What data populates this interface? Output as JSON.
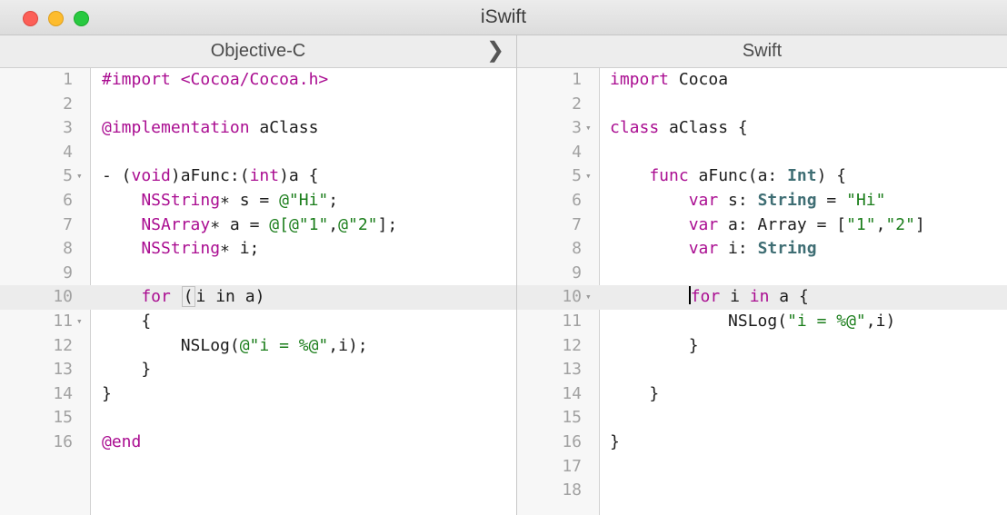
{
  "window": {
    "title": "iSwift"
  },
  "left_pane": {
    "header": "Objective-C",
    "expand_icon": "chevron-right-icon",
    "lines": [
      {
        "num": "1",
        "fold": false,
        "highlight": false,
        "segments": [
          {
            "t": "#import <Cocoa/Cocoa.h>",
            "c": "kw2"
          }
        ]
      },
      {
        "num": "2",
        "fold": false,
        "highlight": false,
        "segments": []
      },
      {
        "num": "3",
        "fold": false,
        "highlight": false,
        "segments": [
          {
            "t": "@implementation",
            "c": "kw"
          },
          {
            "t": " aClass",
            "c": ""
          }
        ]
      },
      {
        "num": "4",
        "fold": false,
        "highlight": false,
        "segments": []
      },
      {
        "num": "5",
        "fold": true,
        "highlight": false,
        "segments": [
          {
            "t": "- (",
            "c": ""
          },
          {
            "t": "void",
            "c": "kw"
          },
          {
            "t": ")aFunc:(",
            "c": ""
          },
          {
            "t": "int",
            "c": "kw"
          },
          {
            "t": ")a {",
            "c": ""
          }
        ]
      },
      {
        "num": "6",
        "fold": false,
        "highlight": false,
        "segments": [
          {
            "t": "    NSString",
            "c": "kw"
          },
          {
            "t": "∗ s = ",
            "c": ""
          },
          {
            "t": "@\"Hi\"",
            "c": "str"
          },
          {
            "t": ";",
            "c": ""
          }
        ]
      },
      {
        "num": "7",
        "fold": false,
        "highlight": false,
        "segments": [
          {
            "t": "    NSArray",
            "c": "kw"
          },
          {
            "t": "∗ a = ",
            "c": ""
          },
          {
            "t": "@[",
            "c": "str"
          },
          {
            "t": "@\"1\"",
            "c": "str"
          },
          {
            "t": ",",
            "c": ""
          },
          {
            "t": "@\"2\"",
            "c": "str"
          },
          {
            "t": "];",
            "c": ""
          }
        ]
      },
      {
        "num": "8",
        "fold": false,
        "highlight": false,
        "segments": [
          {
            "t": "    NSString",
            "c": "kw"
          },
          {
            "t": "∗ i;",
            "c": ""
          }
        ]
      },
      {
        "num": "9",
        "fold": false,
        "highlight": false,
        "segments": []
      },
      {
        "num": "10",
        "fold": false,
        "highlight": true,
        "segments": [
          {
            "t": "    for ",
            "c": "kw"
          },
          {
            "t": "(",
            "c": "brk"
          },
          {
            "t": "i in a)",
            "c": ""
          }
        ]
      },
      {
        "num": "11",
        "fold": true,
        "highlight": false,
        "segments": [
          {
            "t": "    {",
            "c": ""
          }
        ]
      },
      {
        "num": "12",
        "fold": false,
        "highlight": false,
        "segments": [
          {
            "t": "        NSLog(",
            "c": ""
          },
          {
            "t": "@\"i = %@\"",
            "c": "str"
          },
          {
            "t": ",i);",
            "c": ""
          }
        ]
      },
      {
        "num": "13",
        "fold": false,
        "highlight": false,
        "segments": [
          {
            "t": "    }",
            "c": ""
          }
        ]
      },
      {
        "num": "14",
        "fold": false,
        "highlight": false,
        "segments": [
          {
            "t": "}",
            "c": ""
          }
        ]
      },
      {
        "num": "15",
        "fold": false,
        "highlight": false,
        "segments": []
      },
      {
        "num": "16",
        "fold": false,
        "highlight": false,
        "segments": [
          {
            "t": "@end",
            "c": "kw"
          }
        ]
      }
    ]
  },
  "right_pane": {
    "header": "Swift",
    "lines": [
      {
        "num": "1",
        "fold": false,
        "highlight": false,
        "segments": [
          {
            "t": "import ",
            "c": "kw"
          },
          {
            "t": "Cocoa",
            "c": ""
          }
        ]
      },
      {
        "num": "2",
        "fold": false,
        "highlight": false,
        "segments": []
      },
      {
        "num": "3",
        "fold": true,
        "highlight": false,
        "segments": [
          {
            "t": "class ",
            "c": "kw"
          },
          {
            "t": "aClass {",
            "c": ""
          }
        ]
      },
      {
        "num": "4",
        "fold": false,
        "highlight": false,
        "segments": []
      },
      {
        "num": "5",
        "fold": true,
        "highlight": false,
        "segments": [
          {
            "t": "    func ",
            "c": "kw"
          },
          {
            "t": "aFunc(a: ",
            "c": ""
          },
          {
            "t": "Int",
            "c": "ty"
          },
          {
            "t": ") {",
            "c": ""
          }
        ]
      },
      {
        "num": "6",
        "fold": false,
        "highlight": false,
        "segments": [
          {
            "t": "        var ",
            "c": "kw"
          },
          {
            "t": "s: ",
            "c": ""
          },
          {
            "t": "String",
            "c": "ty"
          },
          {
            "t": " = ",
            "c": ""
          },
          {
            "t": "\"Hi\"",
            "c": "str"
          }
        ]
      },
      {
        "num": "7",
        "fold": false,
        "highlight": false,
        "segments": [
          {
            "t": "        var ",
            "c": "kw"
          },
          {
            "t": "a: Array = [",
            "c": ""
          },
          {
            "t": "\"1\"",
            "c": "str"
          },
          {
            "t": ",",
            "c": ""
          },
          {
            "t": "\"2\"",
            "c": "str"
          },
          {
            "t": "]",
            "c": ""
          }
        ]
      },
      {
        "num": "8",
        "fold": false,
        "highlight": false,
        "segments": [
          {
            "t": "        var ",
            "c": "kw"
          },
          {
            "t": "i: ",
            "c": ""
          },
          {
            "t": "String",
            "c": "ty"
          }
        ]
      },
      {
        "num": "9",
        "fold": false,
        "highlight": false,
        "segments": []
      },
      {
        "num": "10",
        "fold": true,
        "highlight": true,
        "segments": [
          {
            "t": "        ",
            "c": ""
          },
          {
            "t": "",
            "c": "cursor"
          },
          {
            "t": "for ",
            "c": "kw"
          },
          {
            "t": "i ",
            "c": ""
          },
          {
            "t": "in ",
            "c": "kw"
          },
          {
            "t": "a {",
            "c": ""
          }
        ]
      },
      {
        "num": "11",
        "fold": false,
        "highlight": false,
        "segments": [
          {
            "t": "            NSLog(",
            "c": ""
          },
          {
            "t": "\"i = %@\"",
            "c": "str"
          },
          {
            "t": ",i)",
            "c": ""
          }
        ]
      },
      {
        "num": "12",
        "fold": false,
        "highlight": false,
        "segments": [
          {
            "t": "        }",
            "c": ""
          }
        ]
      },
      {
        "num": "13",
        "fold": false,
        "highlight": false,
        "segments": []
      },
      {
        "num": "14",
        "fold": false,
        "highlight": false,
        "segments": [
          {
            "t": "    }",
            "c": ""
          }
        ]
      },
      {
        "num": "15",
        "fold": false,
        "highlight": false,
        "segments": []
      },
      {
        "num": "16",
        "fold": false,
        "highlight": false,
        "segments": [
          {
            "t": "}",
            "c": ""
          }
        ]
      },
      {
        "num": "17",
        "fold": false,
        "highlight": false,
        "segments": []
      },
      {
        "num": "18",
        "fold": false,
        "highlight": false,
        "segments": []
      }
    ]
  },
  "colors": {
    "keyword": "#aa0d91",
    "string": "#1a7d1a",
    "type": "#3f6e74",
    "text": "#1b1b1b",
    "line_number": "#a2a2a2"
  }
}
